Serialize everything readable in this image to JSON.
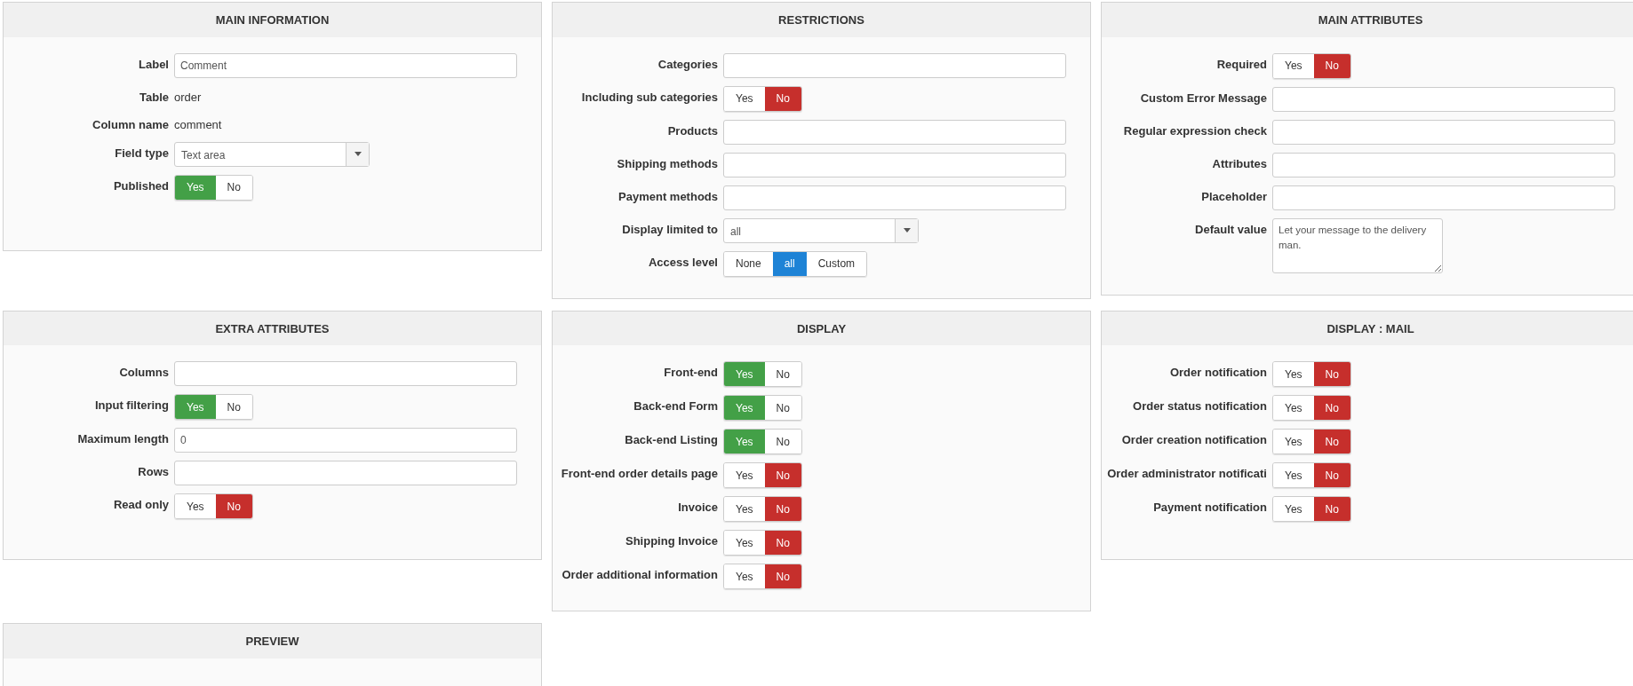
{
  "panels": [
    {
      "title": "MAIN INFORMATION",
      "rows": [
        {
          "kind": "input",
          "label": "Label",
          "value": "Comment"
        },
        {
          "kind": "text",
          "label": "Table",
          "value": "order"
        },
        {
          "kind": "text",
          "label": "Column name",
          "value": "comment"
        },
        {
          "kind": "select",
          "label": "Field type",
          "value": "Text area"
        },
        {
          "kind": "toggle",
          "label": "Published",
          "options": [
            {
              "label": "Yes",
              "selected": true,
              "color": "#43a047"
            },
            {
              "label": "No",
              "selected": false
            }
          ]
        }
      ]
    },
    {
      "title": "RESTRICTIONS",
      "rows": [
        {
          "kind": "input",
          "label": "Categories"
        },
        {
          "kind": "toggle",
          "label": "Including sub categories",
          "options": [
            {
              "label": "Yes",
              "selected": false
            },
            {
              "label": "No",
              "selected": true,
              "color": "#c62f2c"
            }
          ]
        },
        {
          "kind": "input",
          "label": "Products"
        },
        {
          "kind": "input",
          "label": "Shipping methods"
        },
        {
          "kind": "input",
          "label": "Payment methods"
        },
        {
          "kind": "select",
          "label": "Display limited to",
          "value": "all"
        },
        {
          "kind": "toggle",
          "label": "Access level",
          "options": [
            {
              "label": "None",
              "selected": false
            },
            {
              "label": "all",
              "selected": true,
              "color": "#1e83d6"
            },
            {
              "label": "Custom",
              "selected": false
            }
          ]
        }
      ]
    },
    {
      "title": "MAIN ATTRIBUTES",
      "rows": [
        {
          "kind": "toggle",
          "label": "Required",
          "options": [
            {
              "label": "Yes",
              "selected": false
            },
            {
              "label": "No",
              "selected": true,
              "color": "#c62f2c"
            }
          ]
        },
        {
          "kind": "input",
          "label": "Custom Error Message"
        },
        {
          "kind": "input",
          "label": "Regular expression check"
        },
        {
          "kind": "input",
          "label": "Attributes"
        },
        {
          "kind": "input",
          "label": "Placeholder"
        },
        {
          "kind": "textarea",
          "label": "Default value",
          "value": "Let your message to the delivery man."
        }
      ]
    },
    {
      "title": "EXTRA ATTRIBUTES",
      "rows": [
        {
          "kind": "input",
          "label": "Columns"
        },
        {
          "kind": "toggle",
          "label": "Input filtering",
          "options": [
            {
              "label": "Yes",
              "selected": true,
              "color": "#43a047"
            },
            {
              "label": "No",
              "selected": false
            }
          ]
        },
        {
          "kind": "input",
          "label": "Maximum length",
          "value": "0"
        },
        {
          "kind": "input",
          "label": "Rows"
        },
        {
          "kind": "toggle",
          "label": "Read only",
          "options": [
            {
              "label": "Yes",
              "selected": false
            },
            {
              "label": "No",
              "selected": true,
              "color": "#c62f2c"
            }
          ]
        }
      ]
    },
    {
      "title": "DISPLAY",
      "rows": [
        {
          "kind": "toggle",
          "label": "Front-end",
          "options": [
            {
              "label": "Yes",
              "selected": true,
              "color": "#43a047"
            },
            {
              "label": "No",
              "selected": false
            }
          ]
        },
        {
          "kind": "toggle",
          "label": "Back-end Form",
          "options": [
            {
              "label": "Yes",
              "selected": true,
              "color": "#43a047"
            },
            {
              "label": "No",
              "selected": false
            }
          ]
        },
        {
          "kind": "toggle",
          "label": "Back-end Listing",
          "options": [
            {
              "label": "Yes",
              "selected": true,
              "color": "#43a047"
            },
            {
              "label": "No",
              "selected": false
            }
          ]
        },
        {
          "kind": "toggle",
          "label": "Front-end order details page",
          "options": [
            {
              "label": "Yes",
              "selected": false
            },
            {
              "label": "No",
              "selected": true,
              "color": "#c62f2c"
            }
          ]
        },
        {
          "kind": "toggle",
          "label": "Invoice",
          "options": [
            {
              "label": "Yes",
              "selected": false
            },
            {
              "label": "No",
              "selected": true,
              "color": "#c62f2c"
            }
          ]
        },
        {
          "kind": "toggle",
          "label": "Shipping Invoice",
          "options": [
            {
              "label": "Yes",
              "selected": false
            },
            {
              "label": "No",
              "selected": true,
              "color": "#c62f2c"
            }
          ]
        },
        {
          "kind": "toggle",
          "label": "Order additional information",
          "options": [
            {
              "label": "Yes",
              "selected": false
            },
            {
              "label": "No",
              "selected": true,
              "color": "#c62f2c"
            }
          ]
        }
      ]
    },
    {
      "title": "DISPLAY : MAIL",
      "rows": [
        {
          "kind": "toggle",
          "label": "Order notification",
          "options": [
            {
              "label": "Yes",
              "selected": false
            },
            {
              "label": "No",
              "selected": true,
              "color": "#c62f2c"
            }
          ]
        },
        {
          "kind": "toggle",
          "label": "Order status notification",
          "options": [
            {
              "label": "Yes",
              "selected": false
            },
            {
              "label": "No",
              "selected": true,
              "color": "#c62f2c"
            }
          ]
        },
        {
          "kind": "toggle",
          "label": "Order creation notification",
          "options": [
            {
              "label": "Yes",
              "selected": false
            },
            {
              "label": "No",
              "selected": true,
              "color": "#c62f2c"
            }
          ]
        },
        {
          "kind": "toggle",
          "label": "Order administrator notificati",
          "options": [
            {
              "label": "Yes",
              "selected": false
            },
            {
              "label": "No",
              "selected": true,
              "color": "#c62f2c"
            }
          ]
        },
        {
          "kind": "toggle",
          "label": "Payment notification",
          "options": [
            {
              "label": "Yes",
              "selected": false
            },
            {
              "label": "No",
              "selected": true,
              "color": "#c62f2c"
            }
          ]
        }
      ]
    },
    {
      "title": "PREVIEW"
    }
  ]
}
